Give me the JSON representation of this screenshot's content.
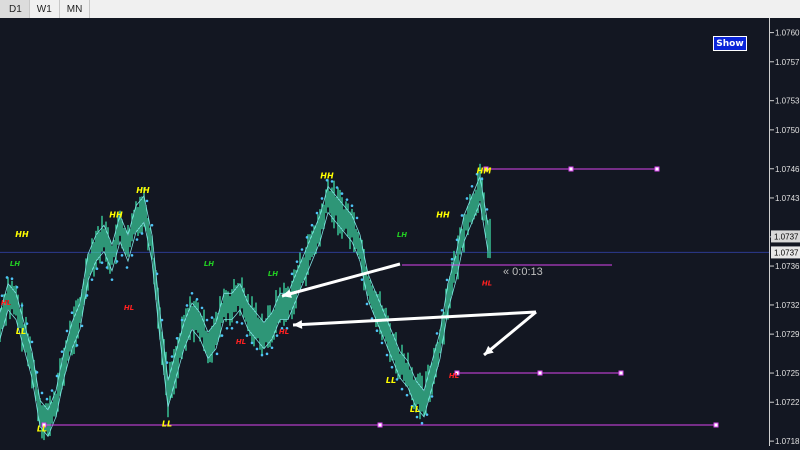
{
  "toolbar": {
    "timeframes": [
      "D1",
      "W1",
      "MN"
    ]
  },
  "show_button": {
    "label": "Show"
  },
  "countdown": {
    "text": "« 0:0:13"
  },
  "colors": {
    "background": "#131722",
    "candles": "#3ddba6",
    "dots": "#4fc3f7",
    "line_thin": "#7fdfe0",
    "magenta": "#d946ef",
    "arrow": "#ffffff",
    "label_yellow": "#ffff00",
    "label_green": "#22cc22",
    "label_red": "#ff2020",
    "current_price_line": "#2b3a8f"
  },
  "chart_data": {
    "type": "line",
    "ylim": [
      1.07175,
      1.07615
    ],
    "y_ticks": [
      1.0718,
      1.0722,
      1.0725,
      1.0729,
      1.0732,
      1.0736,
      1.0739,
      1.0743,
      1.0746,
      1.075,
      1.0753,
      1.0757,
      1.076
    ],
    "y_tick_labels": [
      "1.0718",
      "1.0722",
      "1.0725",
      "1.0729",
      "1.0732",
      "1.0736",
      "1.0739",
      "1.0743",
      "1.0746",
      "1.0750",
      "1.0753",
      "1.0757",
      "1.0760"
    ],
    "current_price_labels": [
      "1.0737",
      "1.0737"
    ],
    "current_price": 1.07374,
    "close_x": [
      0,
      8,
      16,
      24,
      32,
      40,
      48,
      56,
      64,
      72,
      80,
      88,
      96,
      104,
      112,
      120,
      128,
      136,
      144,
      152,
      160,
      168,
      176,
      184,
      192,
      200,
      208,
      216,
      224,
      232,
      240,
      248,
      256,
      264,
      272,
      280,
      288,
      296,
      304,
      312,
      320,
      328,
      336,
      344,
      352,
      360,
      368,
      376,
      384,
      392,
      400,
      408,
      416,
      424,
      432,
      440,
      448,
      456,
      464,
      472,
      480,
      488
    ],
    "close_y": [
      1.073,
      1.0733,
      1.0732,
      1.0729,
      1.0726,
      1.0721,
      1.072,
      1.0722,
      1.0726,
      1.0729,
      1.0731,
      1.0736,
      1.0738,
      1.0739,
      1.0737,
      1.074,
      1.0738,
      1.0741,
      1.0742,
      1.0738,
      1.073,
      1.0723,
      1.0726,
      1.0729,
      1.0731,
      1.073,
      1.0728,
      1.0729,
      1.0732,
      1.0732,
      1.0733,
      1.0731,
      1.073,
      1.0729,
      1.073,
      1.0732,
      1.0732,
      1.0734,
      1.0736,
      1.0738,
      1.074,
      1.0743,
      1.0742,
      1.0741,
      1.074,
      1.0738,
      1.0734,
      1.0732,
      1.073,
      1.0728,
      1.0726,
      1.0725,
      1.0723,
      1.0722,
      1.0725,
      1.0728,
      1.0733,
      1.0736,
      1.074,
      1.0742,
      1.0744,
      1.0739
    ],
    "swing_labels": [
      {
        "text": "HH",
        "type": "yellow",
        "x": 22,
        "y": 1.0739
      },
      {
        "text": "LH",
        "type": "green",
        "x": 15,
        "y": 1.0736
      },
      {
        "text": "HL",
        "type": "red",
        "x": 6,
        "y": 1.0732
      },
      {
        "text": "LL",
        "type": "yellow",
        "x": 21,
        "y": 1.0729
      },
      {
        "text": "LL",
        "type": "yellow",
        "x": 42,
        "y": 1.0719
      },
      {
        "text": "HH",
        "type": "yellow",
        "x": 116,
        "y": 1.0741
      },
      {
        "text": "HH",
        "type": "yellow",
        "x": 143,
        "y": 1.07435
      },
      {
        "text": "HL",
        "type": "red",
        "x": 129,
        "y": 1.07315
      },
      {
        "text": "LL",
        "type": "yellow",
        "x": 167,
        "y": 1.07195
      },
      {
        "text": "LH",
        "type": "green",
        "x": 209,
        "y": 1.0736
      },
      {
        "text": "LH",
        "type": "green",
        "x": 273,
        "y": 1.0735
      },
      {
        "text": "HL",
        "type": "red",
        "x": 241,
        "y": 1.0728
      },
      {
        "text": "HL",
        "type": "red",
        "x": 284,
        "y": 1.0729
      },
      {
        "text": "HH",
        "type": "yellow",
        "x": 327,
        "y": 1.0745
      },
      {
        "text": "LH",
        "type": "green",
        "x": 402,
        "y": 1.0739
      },
      {
        "text": "LL",
        "type": "yellow",
        "x": 391,
        "y": 1.0724
      },
      {
        "text": "HH",
        "type": "yellow",
        "x": 443,
        "y": 1.0741
      },
      {
        "text": "LL",
        "type": "yellow",
        "x": 415,
        "y": 1.0721
      },
      {
        "text": "HL",
        "type": "red",
        "x": 454,
        "y": 1.07245
      },
      {
        "text": "HM",
        "type": "yellow",
        "x": 484,
        "y": 1.07455
      },
      {
        "text": "HL",
        "type": "red",
        "x": 487,
        "y": 1.0734
      }
    ]
  }
}
